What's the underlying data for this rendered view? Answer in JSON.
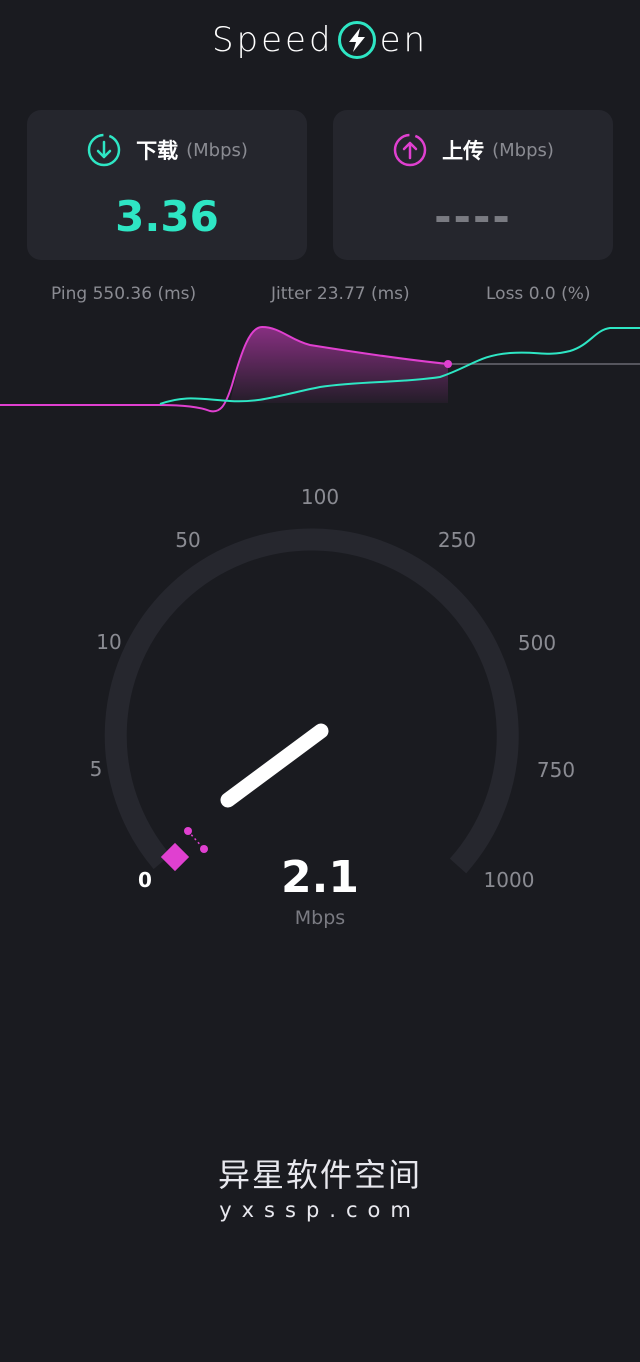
{
  "app": {
    "logo_left": "Speed",
    "logo_right": "en"
  },
  "download": {
    "label": "下载",
    "unit": "(Mbps)",
    "value": "3.36",
    "icon": "download-circle-icon",
    "color": "#2ee6c4"
  },
  "upload": {
    "label": "上传",
    "unit": "(Mbps)",
    "value": "----",
    "icon": "upload-circle-icon",
    "color": "#e040d0"
  },
  "stats": {
    "ping": "Ping 550.36 (ms)",
    "jitter": "Jitter 23.77 (ms)",
    "loss": "Loss 0.0 (%)"
  },
  "gauge": {
    "ticks": [
      "0",
      "5",
      "10",
      "50",
      "100",
      "250",
      "500",
      "750",
      "1000"
    ],
    "value": "2.1",
    "unit": "Mbps",
    "accent": "#e040d0"
  },
  "watermark": {
    "cn": "异星软件空间",
    "en": "yxssp.com"
  }
}
